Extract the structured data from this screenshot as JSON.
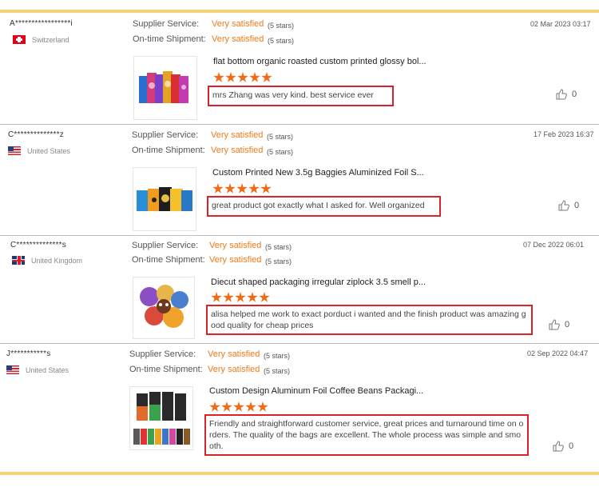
{
  "labels": {
    "supplier_service": "Supplier Service:",
    "ontime_shipment": "On-time Shipment:"
  },
  "reviews": [
    {
      "user": "A*****************i",
      "country": "Switzerland",
      "flag_icon": "flag-switzerland-icon",
      "date": "02 Mar 2023 03:17",
      "supplier_rating_text": "Very satisfied",
      "supplier_stars": "(5 stars)",
      "shipment_rating_text": "Very satisfied",
      "shipment_stars": "(5 stars)",
      "product_title": "flat bottom organic roasted custom printed glossy bol...",
      "rating": 5,
      "comment": "mrs Zhang was very kind. best service ever",
      "likes": "0"
    },
    {
      "user": "C**************z",
      "country": "United States",
      "flag_icon": "flag-usa-icon",
      "date": "17 Feb 2023 16:37",
      "supplier_rating_text": "Very satisfied",
      "supplier_stars": "(5 stars)",
      "shipment_rating_text": "Very satisfied",
      "shipment_stars": "(5 stars)",
      "product_title": "Custom Printed New 3.5g Baggies Aluminized Foil S...",
      "rating": 5,
      "comment": "great product got exactly what I asked for. Well organized",
      "likes": "0"
    },
    {
      "user": "C**************s",
      "country": "United Kingdom",
      "flag_icon": "flag-uk-icon",
      "date": "07 Dec 2022 06:01",
      "supplier_rating_text": "Very satisfied",
      "supplier_stars": "(5 stars)",
      "shipment_rating_text": "Very satisfied",
      "shipment_stars": "(5 stars)",
      "product_title": "Diecut shaped packaging irregular ziplock 3.5 smell p...",
      "rating": 5,
      "comment": "alisa helped me work to exact porduct i wanted and the finish product was amazing good quality for cheap prices",
      "likes": "0"
    },
    {
      "user": "J***********s",
      "country": "United States",
      "flag_icon": "flag-usa-icon",
      "date": "02 Sep 2022 04:47",
      "supplier_rating_text": "Very satisfied",
      "supplier_stars": "(5 stars)",
      "shipment_rating_text": "Very satisfied",
      "shipment_stars": "(5 stars)",
      "product_title": "Custom Design Aluminum Foil Coffee Beans Packagi...",
      "rating": 5,
      "comment": "Friendly and straightforward customer service, great prices and turnaround time on orders. The quality of the bags are excellent. The whole process was simple and smooth.",
      "likes": "0"
    }
  ],
  "colors": {
    "accent": "#f07a1a",
    "star": "#f26a13",
    "highlight_border": "#d8232a",
    "top_bar": "#f3d27a"
  }
}
